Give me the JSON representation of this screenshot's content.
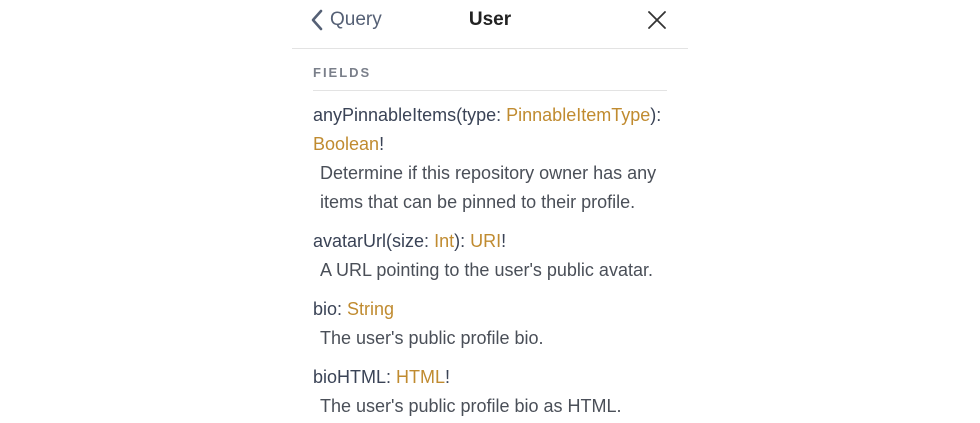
{
  "header": {
    "back_label": "Query",
    "title": "User"
  },
  "section": {
    "title": "FIELDS"
  },
  "fields": [
    {
      "name": "anyPinnableItems",
      "arg_name": "type",
      "arg_type": "PinnableItemType",
      "return_type": "Boolean",
      "nonnull": "!",
      "description": "Determine if this repository owner has any items that can be pinned to their profile."
    },
    {
      "name": "avatarUrl",
      "arg_name": "size",
      "arg_type": "Int",
      "return_type": "URI",
      "nonnull": "!",
      "description": "A URL pointing to the user's public avatar."
    },
    {
      "name": "bio",
      "return_type": "String",
      "description": "The user's public profile bio."
    },
    {
      "name": "bioHTML",
      "return_type": "HTML",
      "nonnull": "!",
      "description": "The user's public profile bio as HTML."
    }
  ],
  "icons": {
    "back": "chevron-left-icon",
    "close": "close-icon"
  },
  "colors": {
    "type_ref": "#c08b30",
    "text": "#3a4356"
  }
}
